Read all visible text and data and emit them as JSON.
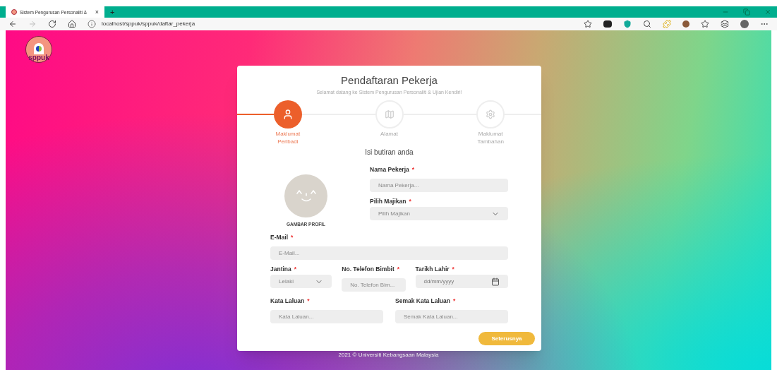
{
  "browser": {
    "tab": {
      "title": "Sistem Pengurusan Personaliti &",
      "close": "×"
    },
    "new_tab": "+",
    "url": "localhost/sppuk/sppuk/daftar_pekerja"
  },
  "logo": {
    "text": "sppuk"
  },
  "card": {
    "title": "Pendaftaran Pekerja",
    "subtitle": "Selamat datang ke Sistem Pengurusan Personaliti & Ujian Kendiri!",
    "steps": [
      {
        "label": "Maklumat Peribadi",
        "kind": "user",
        "selected": true
      },
      {
        "label": "Alamat",
        "kind": "map",
        "selected": false
      },
      {
        "label": "Maklumat Tambahan",
        "kind": "gear",
        "selected": false
      }
    ],
    "section_title": "Isi butiran anda",
    "avatar_caption": "GAMBAR PROFIL",
    "side_fields": [
      {
        "kind": "text",
        "label": "Nama Pekerja",
        "mark": "*",
        "placeholder": "Nama Pekerja..."
      },
      {
        "kind": "select",
        "label": "Pilih Majikan",
        "mark": "*",
        "value": "Pilih Majikan"
      }
    ],
    "email_field": {
      "kind": "text",
      "label": "E-Mail",
      "mark": "*",
      "placeholder": "E-Mail..."
    },
    "row_fields": [
      {
        "kind": "select",
        "label": "Jantina",
        "mark": "*",
        "value": "Lelaki"
      },
      {
        "kind": "text",
        "label": "No. Telefon Bimbit",
        "mark": "*",
        "placeholder": "No. Telefon Bim..."
      },
      {
        "kind": "date",
        "label": "Tarikh Lahir",
        "mark": "*",
        "value": "dd/mm/yyyy"
      }
    ],
    "password_fields": [
      {
        "kind": "text",
        "label": "Kata Laluan",
        "mark": "*",
        "placeholder": "Kata Laluan..."
      },
      {
        "kind": "text",
        "label": "Semak Kata Laluan",
        "mark": "*",
        "placeholder": "Semak Kata Laluan..."
      }
    ],
    "next_button": "Seterusnya"
  },
  "footer": "2021 © Universiti Kebangsaan Malaysia"
}
